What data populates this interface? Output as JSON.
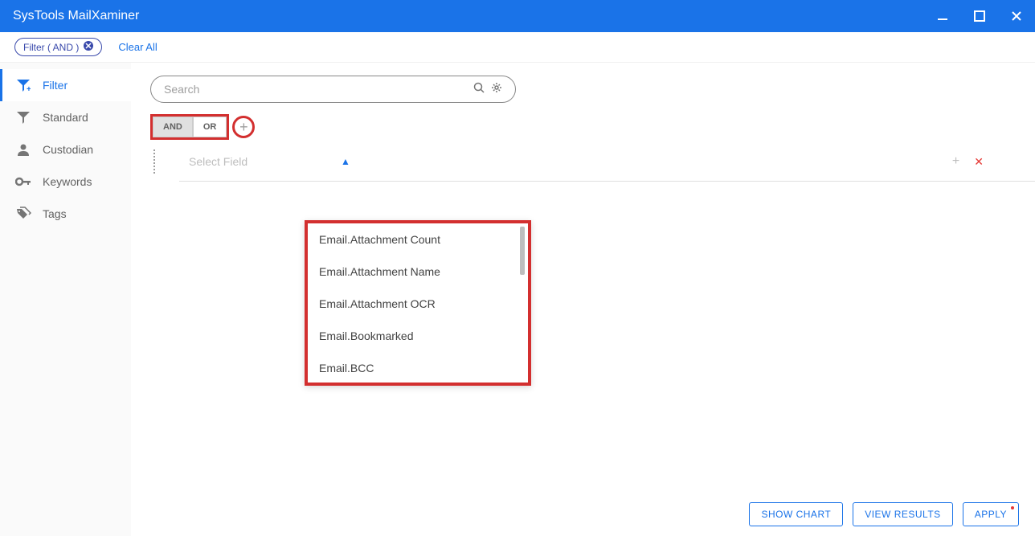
{
  "window": {
    "title": "SysTools MailXaminer"
  },
  "header": {
    "filter_pill": "Filter ( AND )",
    "clear_all": "Clear All"
  },
  "sidebar": {
    "items": [
      {
        "label": "Filter",
        "key": "filter"
      },
      {
        "label": "Standard",
        "key": "standard"
      },
      {
        "label": "Custodian",
        "key": "custodian"
      },
      {
        "label": "Keywords",
        "key": "keywords"
      },
      {
        "label": "Tags",
        "key": "tags"
      }
    ]
  },
  "search": {
    "placeholder": "Search"
  },
  "toggle": {
    "and": "AND",
    "or": "OR"
  },
  "field_row": {
    "placeholder": "Select Field"
  },
  "dropdown": {
    "items": [
      "Email.Attachment Count",
      "Email.Attachment Name",
      "Email.Attachment OCR",
      "Email.Bookmarked",
      "Email.BCC"
    ]
  },
  "footer": {
    "show_chart": "SHOW CHART",
    "view_results": "VIEW RESULTS",
    "apply": "APPLY"
  }
}
